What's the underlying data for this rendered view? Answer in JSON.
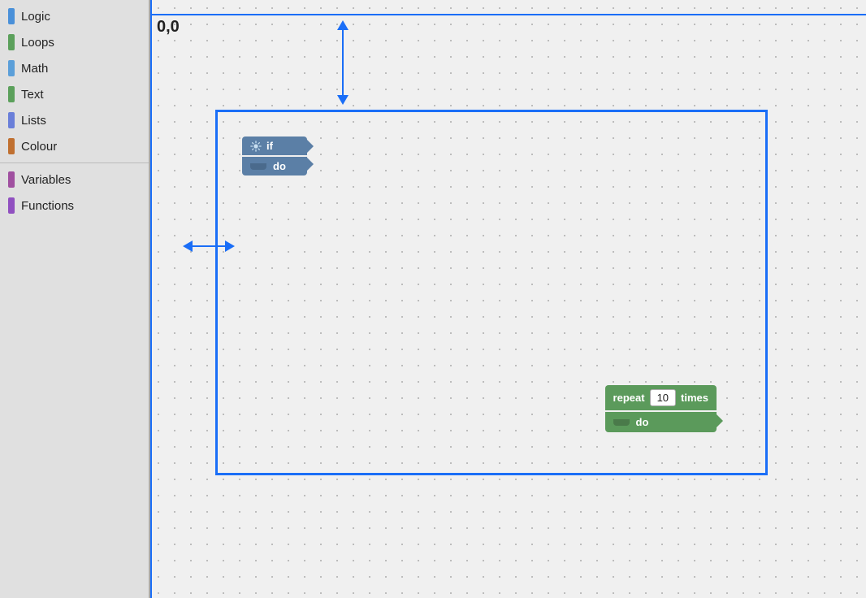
{
  "sidebar": {
    "items": [
      {
        "id": "logic",
        "label": "Logic",
        "color": "#4a90d9"
      },
      {
        "id": "loops",
        "label": "Loops",
        "color": "#5ba05b"
      },
      {
        "id": "math",
        "label": "Math",
        "color": "#5b9fd9"
      },
      {
        "id": "text",
        "label": "Text",
        "color": "#5ba05b"
      },
      {
        "id": "lists",
        "label": "Lists",
        "color": "#6a7fd9"
      },
      {
        "id": "colour",
        "label": "Colour",
        "color": "#c07030"
      },
      {
        "id": "variables",
        "label": "Variables",
        "color": "#a050a0"
      },
      {
        "id": "functions",
        "label": "Functions",
        "color": "#9050c0"
      }
    ]
  },
  "workspace": {
    "coord_label": "0,0",
    "if_block": {
      "if_label": "if",
      "do_label": "do"
    },
    "repeat_block": {
      "repeat_label": "repeat",
      "times_label": "times",
      "number_value": "10",
      "do_label": "do"
    }
  }
}
